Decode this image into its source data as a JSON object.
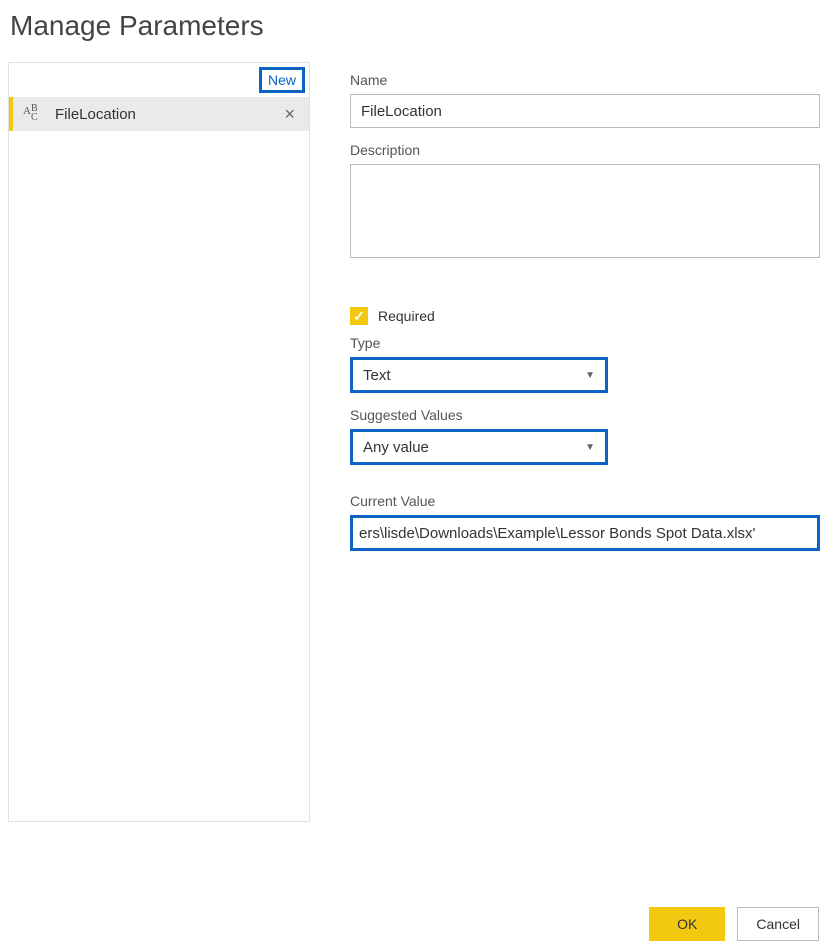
{
  "dialog": {
    "title": "Manage Parameters"
  },
  "leftPanel": {
    "newButton": "New",
    "items": [
      {
        "name": "FileLocation"
      }
    ]
  },
  "form": {
    "nameLabel": "Name",
    "nameValue": "FileLocation",
    "descriptionLabel": "Description",
    "descriptionValue": "",
    "requiredLabel": "Required",
    "requiredChecked": true,
    "typeLabel": "Type",
    "typeValue": "Text",
    "suggestedLabel": "Suggested Values",
    "suggestedValue": "Any value",
    "currentValueLabel": "Current Value",
    "currentValue": "ers\\lisde\\Downloads\\Example\\Lessor Bonds Spot Data.xlsx'"
  },
  "buttons": {
    "ok": "OK",
    "cancel": "Cancel"
  }
}
